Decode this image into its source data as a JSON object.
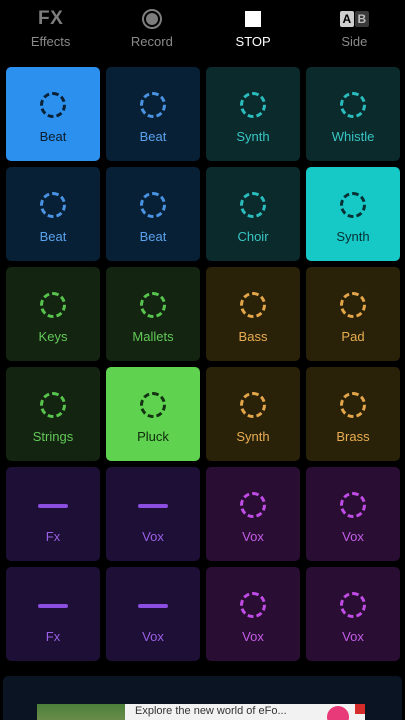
{
  "toolbar": {
    "effects": {
      "glyph": "FX",
      "label": "Effects"
    },
    "record": {
      "label": "Record"
    },
    "stop": {
      "label": "STOP"
    },
    "side": {
      "glyph_a": "A",
      "glyph_b": "B",
      "label": "Side"
    }
  },
  "pads": [
    {
      "label": "Beat",
      "color": "blue",
      "active": true,
      "shape": "ring"
    },
    {
      "label": "Beat",
      "color": "blue",
      "active": false,
      "shape": "ring"
    },
    {
      "label": "Synth",
      "color": "teal",
      "active": false,
      "shape": "ring"
    },
    {
      "label": "Whistle",
      "color": "teal",
      "active": false,
      "shape": "ring"
    },
    {
      "label": "Beat",
      "color": "blue",
      "active": false,
      "shape": "ring"
    },
    {
      "label": "Beat",
      "color": "blue",
      "active": false,
      "shape": "ring"
    },
    {
      "label": "Choir",
      "color": "teal",
      "active": false,
      "shape": "ring"
    },
    {
      "label": "Synth",
      "color": "teal",
      "active": true,
      "shape": "ring"
    },
    {
      "label": "Keys",
      "color": "green",
      "active": false,
      "shape": "ring"
    },
    {
      "label": "Mallets",
      "color": "green",
      "active": false,
      "shape": "ring"
    },
    {
      "label": "Bass",
      "color": "amber",
      "active": false,
      "shape": "ring"
    },
    {
      "label": "Pad",
      "color": "amber",
      "active": false,
      "shape": "ring"
    },
    {
      "label": "Strings",
      "color": "green",
      "active": false,
      "shape": "ring"
    },
    {
      "label": "Pluck",
      "color": "green",
      "active": true,
      "shape": "ring"
    },
    {
      "label": "Synth",
      "color": "amber",
      "active": false,
      "shape": "ring"
    },
    {
      "label": "Brass",
      "color": "amber",
      "active": false,
      "shape": "ring"
    },
    {
      "label": "Fx",
      "color": "purple",
      "active": false,
      "shape": "bar"
    },
    {
      "label": "Vox",
      "color": "purple",
      "active": false,
      "shape": "bar"
    },
    {
      "label": "Vox",
      "color": "magenta",
      "active": false,
      "shape": "ring"
    },
    {
      "label": "Vox",
      "color": "magenta",
      "active": false,
      "shape": "ring"
    },
    {
      "label": "Fx",
      "color": "purple",
      "active": false,
      "shape": "bar"
    },
    {
      "label": "Vox",
      "color": "purple",
      "active": false,
      "shape": "bar"
    },
    {
      "label": "Vox",
      "color": "magenta",
      "active": false,
      "shape": "ring"
    },
    {
      "label": "Vox",
      "color": "magenta",
      "active": false,
      "shape": "ring"
    }
  ],
  "ad": {
    "text": "Explore the new world of eFo..."
  }
}
